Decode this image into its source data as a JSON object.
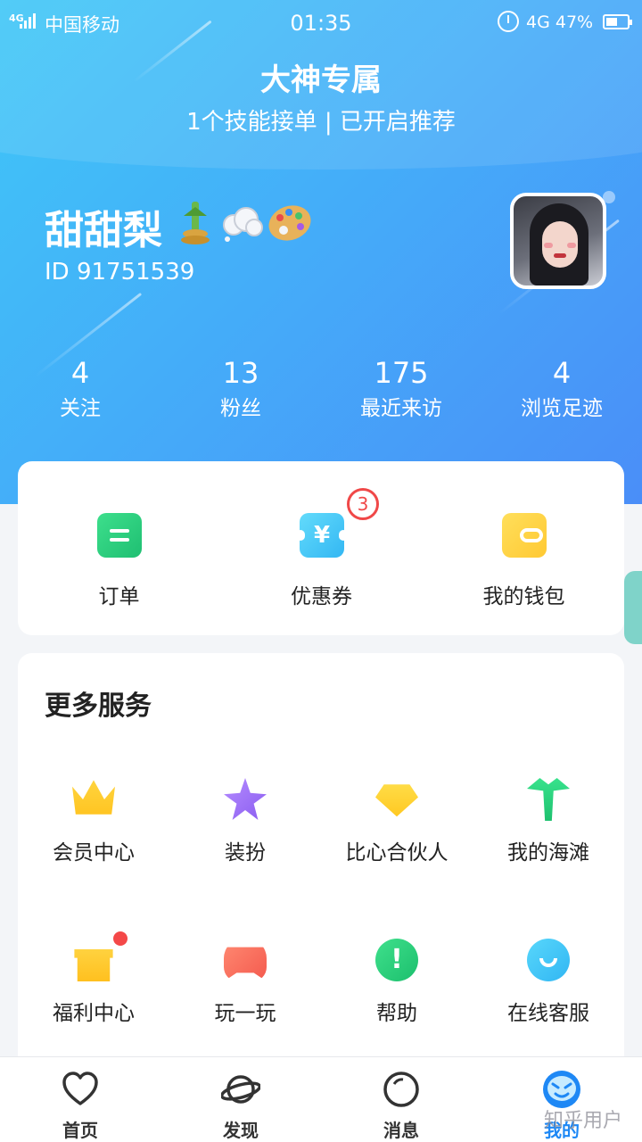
{
  "status_bar": {
    "network_tag": "4G",
    "carrier": "中国移动",
    "time": "01:35",
    "network": "4G",
    "battery": "47%"
  },
  "header": {
    "title": "大神专属",
    "subtitle": "1个技能接单 | 已开启推荐"
  },
  "profile": {
    "name": "甜甜梨",
    "id": "ID 91751539",
    "badges": [
      "bamboo-decoration-icon",
      "cloud-icon",
      "palette-icon"
    ]
  },
  "stats": [
    {
      "value": "4",
      "label": "关注"
    },
    {
      "value": "13",
      "label": "粉丝"
    },
    {
      "value": "175",
      "label": "最近来访"
    },
    {
      "value": "4",
      "label": "浏览足迹"
    }
  ],
  "quick_actions": [
    {
      "label": "订单",
      "icon": "order-icon"
    },
    {
      "label": "优惠券",
      "icon": "coupon-icon",
      "badge": "3",
      "symbol": "¥"
    },
    {
      "label": "我的钱包",
      "icon": "wallet-icon"
    }
  ],
  "more_services": {
    "title": "更多服务",
    "items": [
      {
        "label": "会员中心",
        "icon": "crown-icon"
      },
      {
        "label": "装扮",
        "icon": "star-icon"
      },
      {
        "label": "比心合伙人",
        "icon": "diamond-icon"
      },
      {
        "label": "我的海滩",
        "icon": "palm-tree-icon"
      },
      {
        "label": "福利中心",
        "icon": "gift-icon",
        "red_dot": true
      },
      {
        "label": "玩一玩",
        "icon": "gamepad-icon"
      },
      {
        "label": "帮助",
        "icon": "help-icon",
        "symbol": "!"
      },
      {
        "label": "在线客服",
        "icon": "customer-service-icon"
      }
    ]
  },
  "tab_bar": [
    {
      "label": "首页",
      "icon": "heart-icon"
    },
    {
      "label": "发现",
      "icon": "planet-icon"
    },
    {
      "label": "消息",
      "icon": "message-bubble-icon"
    },
    {
      "label": "我的",
      "icon": "profile-face-icon",
      "active": true
    }
  ],
  "watermark": "知乎用户",
  "colors": {
    "accent": "#1e88f5",
    "hero_start": "#3fc7f7",
    "hero_end": "#4a8ef8",
    "badge_red": "#f04848"
  }
}
